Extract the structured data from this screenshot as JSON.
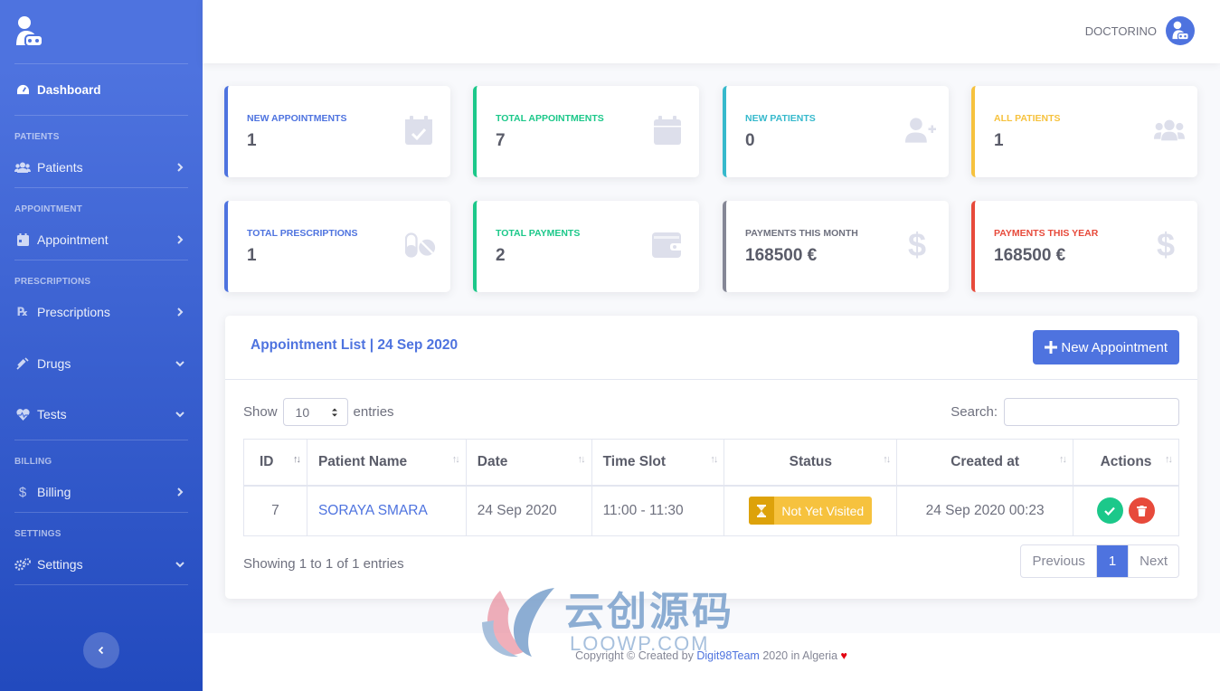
{
  "app": {
    "user_name": "DOCTORINO"
  },
  "sidebar": {
    "dashboard_label": "Dashboard",
    "sections": [
      {
        "heading": "PATIENTS",
        "item": "Patients",
        "icon": "users-icon",
        "chevron": "right"
      },
      {
        "heading": "APPOINTMENT",
        "item": "Appointment",
        "icon": "calendar-icon",
        "chevron": "right"
      },
      {
        "heading": "PRESCRIPTIONS",
        "item": "Prescriptions",
        "icon": "prescription-icon",
        "chevron": "right"
      },
      {
        "heading": "",
        "item": "Drugs",
        "icon": "syringe-icon",
        "chevron": "down"
      },
      {
        "heading": "",
        "item": "Tests",
        "icon": "heartbeat-icon",
        "chevron": "down"
      },
      {
        "heading": "BILLING",
        "item": "Billing",
        "icon": "dollar-icon",
        "chevron": "right"
      },
      {
        "heading": "SETTINGS",
        "item": "Settings",
        "icon": "cogs-icon",
        "chevron": "down"
      }
    ]
  },
  "stats": [
    {
      "label": "NEW APPOINTMENTS",
      "value": "1",
      "color": "#4e73df",
      "icon": "calendar-check-icon"
    },
    {
      "label": "TOTAL APPOINTMENTS",
      "value": "7",
      "color": "#1cc88a",
      "icon": "calendar-icon"
    },
    {
      "label": "NEW PATIENTS",
      "value": "0",
      "color": "#36b9cc",
      "icon": "user-plus-icon"
    },
    {
      "label": "ALL PATIENTS",
      "value": "1",
      "color": "#f6c23e",
      "icon": "users-icon"
    },
    {
      "label": "TOTAL PRESCRIPTIONS",
      "value": "1",
      "color": "#4e73df",
      "icon": "pills-icon"
    },
    {
      "label": "TOTAL PAYMENTS",
      "value": "2",
      "color": "#1cc88a",
      "icon": "wallet-icon"
    },
    {
      "label": "PAYMENTS THIS MONTH",
      "value": "168500 €",
      "color": "#858796",
      "icon": "dollar-icon"
    },
    {
      "label": "PAYMENTS THIS YEAR",
      "value": "168500 €",
      "color": "#e74a3b",
      "icon": "dollar-icon"
    }
  ],
  "appointments": {
    "title": "Appointment List | 24 Sep 2020",
    "new_button": "New Appointment",
    "show_label": "Show",
    "entries_label": "entries",
    "page_length": "10",
    "search_label": "Search:",
    "search_value": "",
    "columns": [
      "ID",
      "Patient Name",
      "Date",
      "Time Slot",
      "Status",
      "Created at",
      "Actions"
    ],
    "rows": [
      {
        "id": "7",
        "patient": "SORAYA SMARA",
        "date": "24 Sep 2020",
        "time_slot": "11:00 - 11:30",
        "status": "Not Yet Visited",
        "created_at": "24 Sep 2020 00:23"
      }
    ],
    "info": "Showing 1 to 1 of 1 entries",
    "pagination": {
      "previous": "Previous",
      "current": "1",
      "next": "Next"
    }
  },
  "footer": {
    "prefix": "Copyright © Created by ",
    "team": "Digit98Team",
    "suffix": " 2020 in Algeria "
  },
  "watermark": {
    "cn": "云创源码",
    "en": "LOOWP.COM"
  }
}
